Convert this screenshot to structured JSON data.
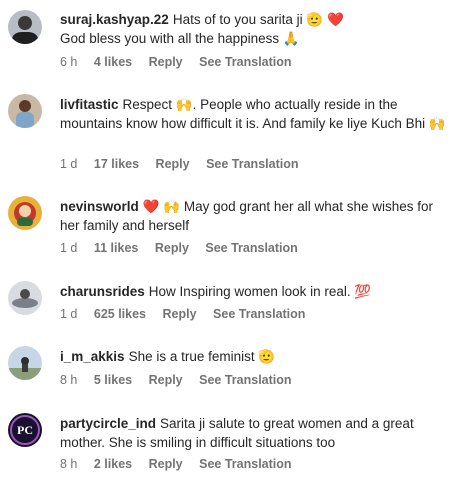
{
  "comments": [
    {
      "username": "suraj.kashyap.22",
      "text": "Hats of to you sarita ji 🫡 ❤️",
      "text2": "God bless you with all the happiness 🙏",
      "time": "6 h",
      "likes": "4 likes",
      "reply": "Reply",
      "translate": "See Translation"
    },
    {
      "username": "livfitastic",
      "text": "Respect 🙌. People who actually reside in the mountains know how difficult it is. And family ke liye Kuch Bhi 🙌",
      "time": "1 d",
      "likes": "17 likes",
      "reply": "Reply",
      "translate": "See Translation"
    },
    {
      "username": "nevinsworld",
      "text": "❤️ 🙌 May god grant her all what she wishes for her family and herself",
      "time": "1 d",
      "likes": "11 likes",
      "reply": "Reply",
      "translate": "See Translation"
    },
    {
      "username": "charunsrides",
      "text": "How Inspiring women look in real. 💯",
      "time": "1 d",
      "likes": "625 likes",
      "reply": "Reply",
      "translate": "See Translation"
    },
    {
      "username": "i_m_akkis",
      "text": "She is a true feminist 🫡",
      "time": "8 h",
      "likes": "5 likes",
      "reply": "Reply",
      "translate": "See Translation"
    },
    {
      "username": "partycircle_ind",
      "text": "Sarita ji salute to great women and a great mother. She is smiling in difficult situations too",
      "time": "8 h",
      "likes": "2 likes",
      "reply": "Reply",
      "translate": "See Translation",
      "avatar_text": "PC"
    }
  ]
}
